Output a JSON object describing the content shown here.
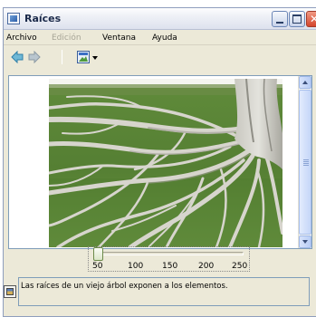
{
  "window": {
    "title": "Raíces",
    "controls": [
      "minimize",
      "maximize",
      "close"
    ]
  },
  "menubar": {
    "items": [
      {
        "label": "Archivo",
        "enabled": true
      },
      {
        "label": "Edición",
        "enabled": false
      },
      {
        "label": "Ventana",
        "enabled": true
      },
      {
        "label": "Ayuda",
        "enabled": true
      }
    ]
  },
  "toolbar": {
    "back_icon": "back-arrow-icon",
    "forward_icon": "forward-arrow-icon",
    "view_icon": "picture-view-icon"
  },
  "viewer": {
    "image_subject": "tree-roots-photo"
  },
  "slider": {
    "ticks": [
      "50",
      "100",
      "150",
      "200",
      "250"
    ],
    "value": 50
  },
  "status": {
    "text": "Las raíces de un viejo árbol exponen a los elementos.",
    "icon": "picture-icon"
  },
  "colors": {
    "accent": "#7f9db9",
    "close_button": "#d4452c",
    "frame": "#ece9d8"
  }
}
